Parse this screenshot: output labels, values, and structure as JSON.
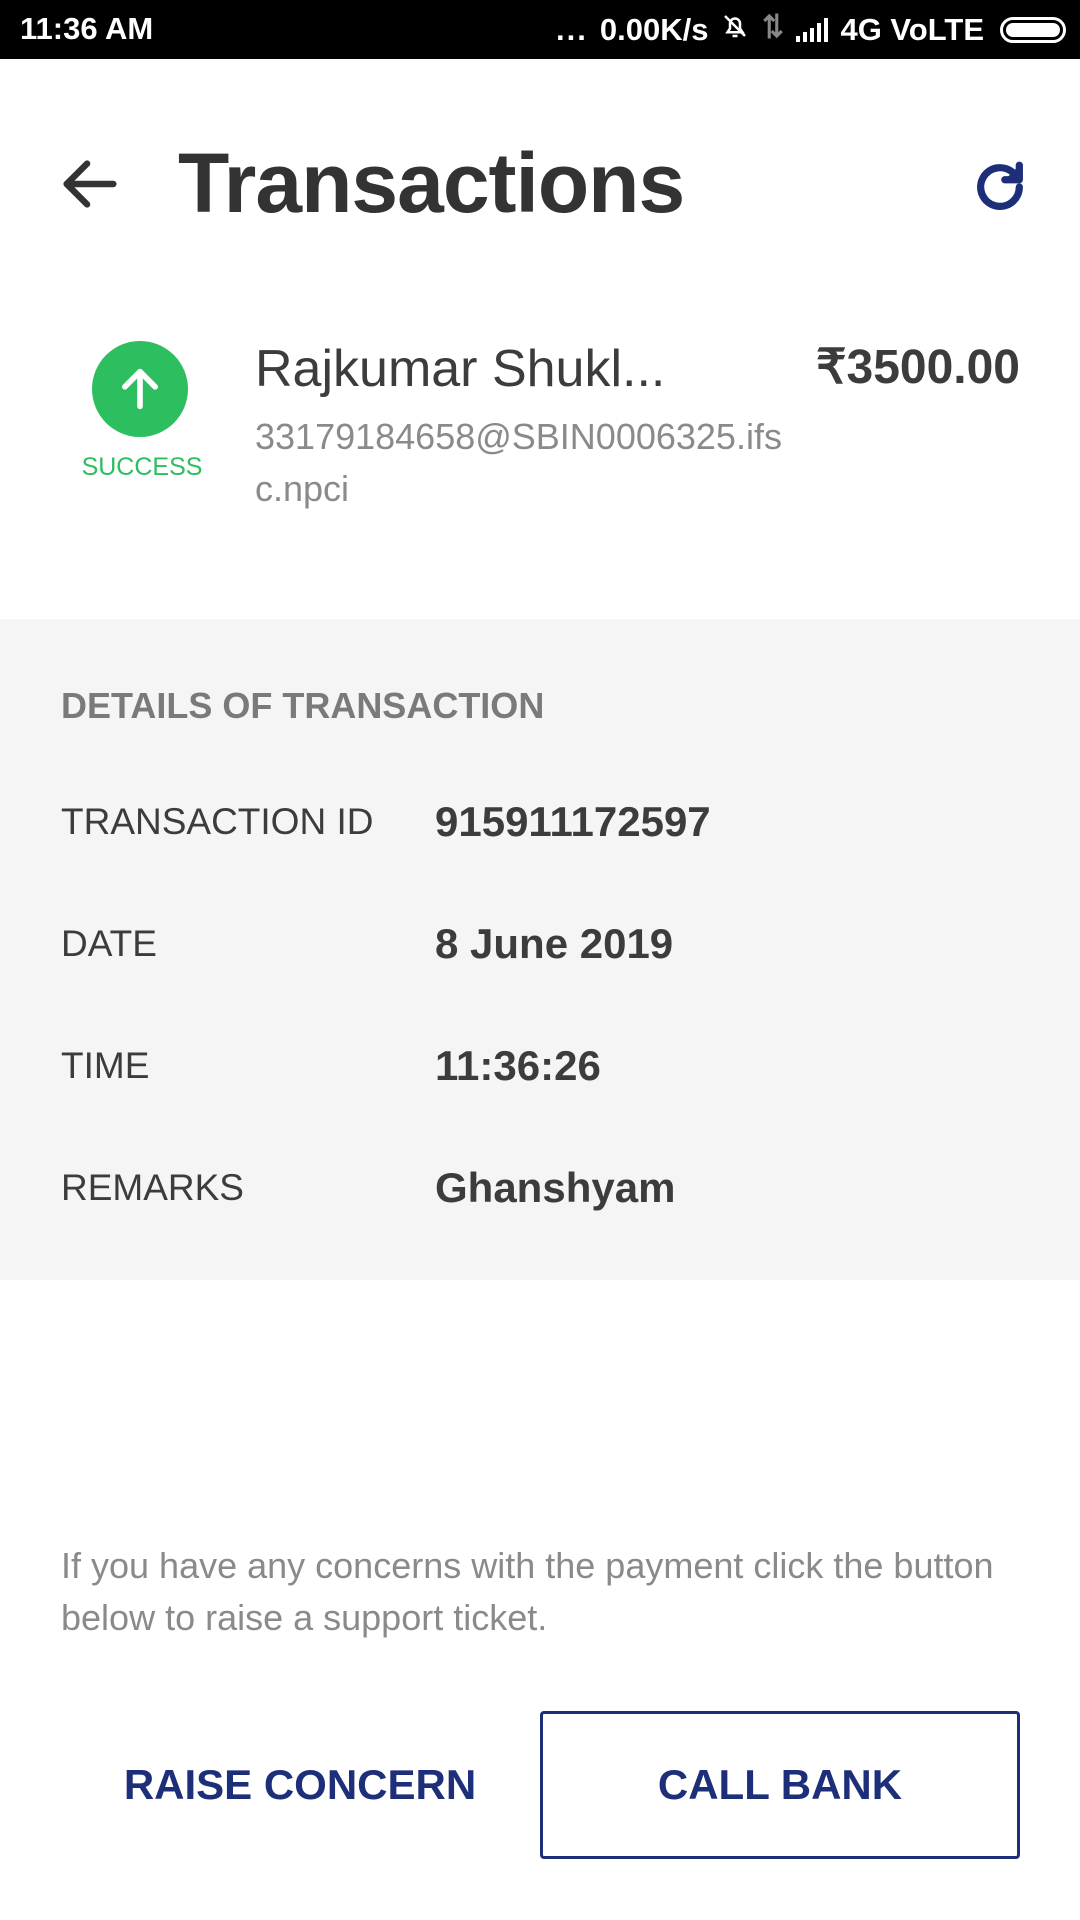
{
  "status_bar": {
    "time": "11:36 AM",
    "more": "...",
    "net_speed": "0.00K/s",
    "network": "4G VoLTE"
  },
  "header": {
    "title": "Transactions"
  },
  "transaction": {
    "status": "SUCCESS",
    "payee_name": "Rajkumar Shukl...",
    "payee_vpa": "33179184658@SBIN0006325.ifsc.npci",
    "amount": "₹3500.00"
  },
  "details": {
    "title": "DETAILS OF TRANSACTION",
    "rows": [
      {
        "label": "TRANSACTION ID",
        "value": "915911172597"
      },
      {
        "label": "DATE",
        "value": "8 June 2019"
      },
      {
        "label": "TIME",
        "value": "11:36:26"
      },
      {
        "label": "REMARKS",
        "value": "Ghanshyam"
      }
    ]
  },
  "concern_note": "If you have any concerns with the payment click the button below to raise a support ticket.",
  "actions": {
    "raise_concern": "RAISE CONCERN",
    "call_bank": "CALL BANK"
  },
  "colors": {
    "success": "#2dbe60",
    "accent": "#1e2f7a",
    "panel_bg": "#f5f5f5"
  },
  "icons": {
    "back": "arrow-left-icon",
    "refresh": "refresh-icon",
    "status": "arrow-up-icon",
    "mute": "bell-off-icon",
    "data": "data-arrows-icon",
    "signal": "signal-icon",
    "battery": "battery-icon"
  }
}
